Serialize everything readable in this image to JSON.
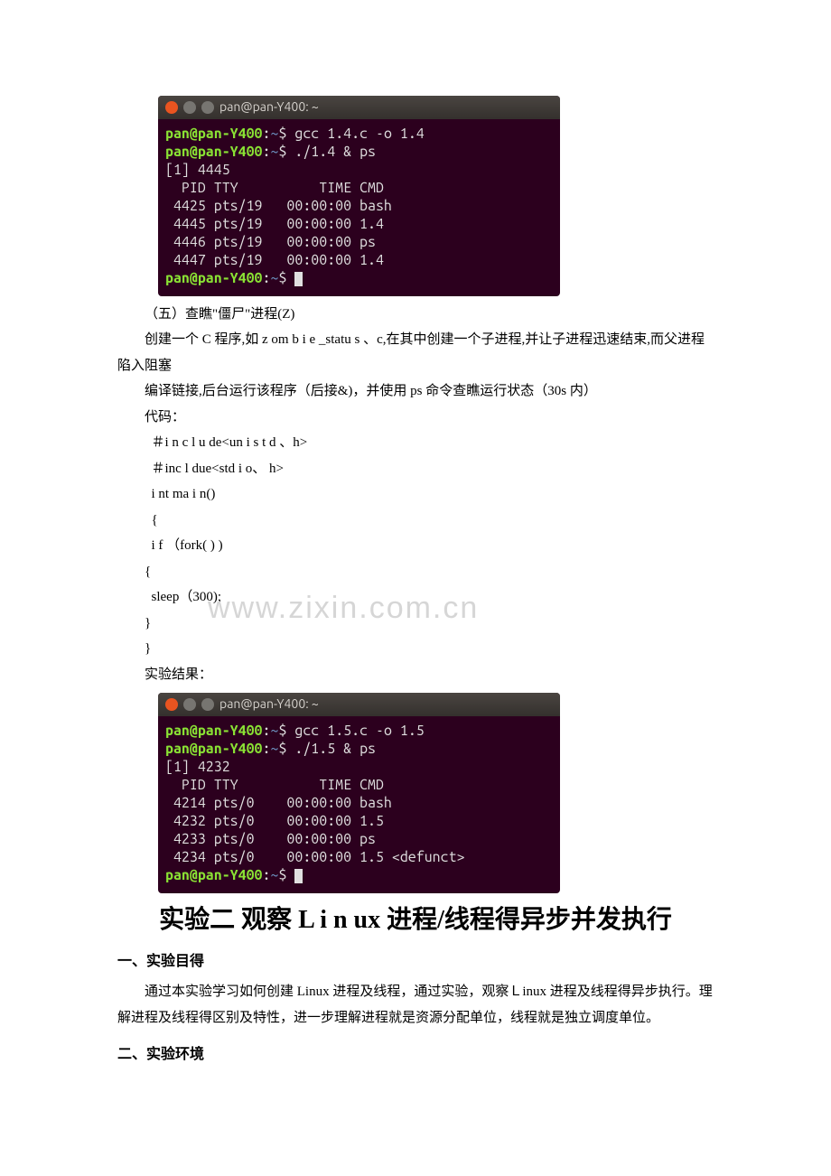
{
  "terminal1": {
    "title": "pan@pan-Y400: ~",
    "lines": {
      "l1_user": "pan@pan-Y400",
      "l1_path": "~",
      "l1_cmd": "gcc 1.4.c -o 1.4",
      "l2_user": "pan@pan-Y400",
      "l2_path": "~",
      "l2_cmd": "./1.4 & ps",
      "job": "[1] 4445",
      "hdr": "  PID TTY          TIME CMD",
      "r1": " 4425 pts/19   00:00:00 bash",
      "r2": " 4445 pts/19   00:00:00 1.4",
      "r3": " 4446 pts/19   00:00:00 ps",
      "r4": " 4447 pts/19   00:00:00 1.4",
      "l3_user": "pan@pan-Y400",
      "l3_path": "~"
    }
  },
  "section5": {
    "title": "（五）查瞧\"僵尸\"进程(Z)",
    "p1": "创建一个 C 程序,如 z om b i e _statu s 、c,在其中创建一个子进程,并让子进程迅速结束,而父进程陷入阻塞",
    "p2": "编译链接,后台运行该程序（后接&)，并使用 ps 命令查瞧运行状态（30s 内）",
    "codeLabel": "代码：",
    "c1": "＃i n c l u de<un i s t d 、h>",
    "c2": "＃inc l due<std i o、 h>",
    "c3": " i nt ma i n()",
    "c4": " {",
    "c5": "  i f （fork( ) )",
    "c6": "{",
    "c7": "  sleep（300);",
    "c8": "}",
    "c9": "}",
    "resultLabel": "实验结果："
  },
  "watermark": "www.zixin.com.cn",
  "terminal2": {
    "title": "pan@pan-Y400: ~",
    "lines": {
      "l1_user": "pan@pan-Y400",
      "l1_path": "~",
      "l1_cmd": "gcc 1.5.c -o 1.5",
      "l2_user": "pan@pan-Y400",
      "l2_path": "~",
      "l2_cmd": "./1.5 & ps",
      "job": "[1] 4232",
      "hdr": "  PID TTY          TIME CMD",
      "r1": " 4214 pts/0    00:00:00 bash",
      "r2": " 4232 pts/0    00:00:00 1.5",
      "r3": " 4233 pts/0    00:00:00 ps",
      "r4": " 4234 pts/0    00:00:00 1.5 <defunct>",
      "l3_user": "pan@pan-Y400",
      "l3_path": "~"
    }
  },
  "experiment2": {
    "title": "实验二  观察 L i n ux 进程/线程得异步并发执行",
    "s1_title": "一、实验目得",
    "s1_p": "通过本实验学习如何创建 Linux 进程及线程，通过实验，观察Ｌinux 进程及线程得异步执行。理解进程及线程得区别及特性，进一步理解进程就是资源分配单位，线程就是独立调度单位。",
    "s2_title": "二、实验环境"
  }
}
